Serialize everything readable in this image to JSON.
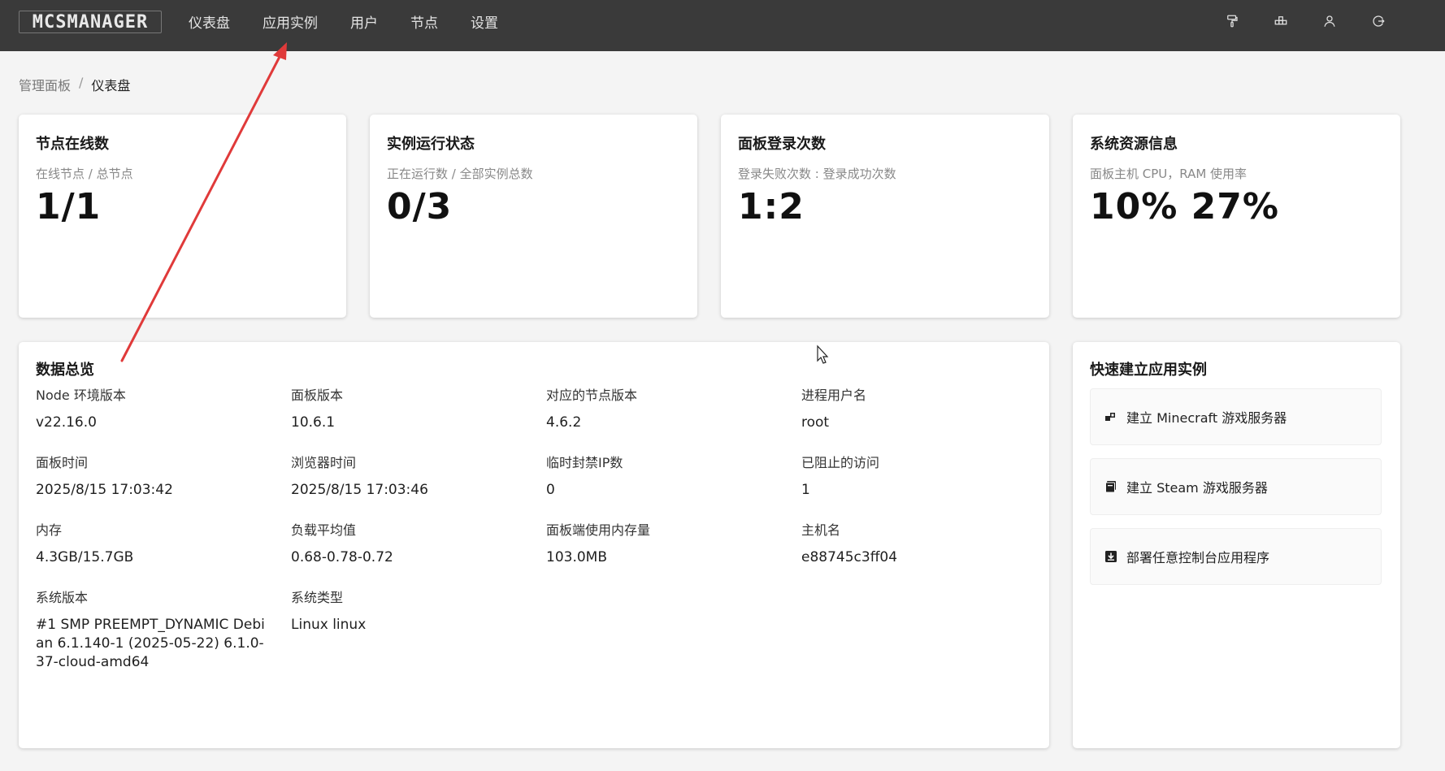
{
  "topbar": {
    "logo": "MCSMANAGER",
    "nav": [
      "仪表盘",
      "应用实例",
      "用户",
      "节点",
      "设置"
    ],
    "icons": [
      "paint-roller-icon",
      "cluster-icon",
      "user-icon",
      "logout-icon"
    ]
  },
  "breadcrumb": {
    "root": "管理面板",
    "separator": "/",
    "current": "仪表盘"
  },
  "stats": [
    {
      "title": "节点在线数",
      "subtitle": "在线节点 / 总节点",
      "value": "1/1"
    },
    {
      "title": "实例运行状态",
      "subtitle": "正在运行数 / 全部实例总数",
      "value": "0/3"
    },
    {
      "title": "面板登录次数",
      "subtitle": "登录失败次数 : 登录成功次数",
      "value": "1:2"
    },
    {
      "title": "系统资源信息",
      "subtitle": "面板主机 CPU，RAM 使用率",
      "value": "10% 27%"
    }
  ],
  "overview": {
    "title": "数据总览",
    "items": [
      {
        "label": "Node 环境版本",
        "value": "v22.16.0"
      },
      {
        "label": "面板版本",
        "value": "10.6.1"
      },
      {
        "label": "对应的节点版本",
        "value": "4.6.2"
      },
      {
        "label": "进程用户名",
        "value": "root"
      },
      {
        "label": "面板时间",
        "value": "2025/8/15 17:03:42"
      },
      {
        "label": "浏览器时间",
        "value": "2025/8/15 17:03:46"
      },
      {
        "label": "临时封禁IP数",
        "value": "0"
      },
      {
        "label": "已阻止的访问",
        "value": "1"
      },
      {
        "label": "内存",
        "value": "4.3GB/15.7GB"
      },
      {
        "label": "负载平均值",
        "value": "0.68-0.78-0.72"
      },
      {
        "label": "面板端使用内存量",
        "value": "103.0MB"
      },
      {
        "label": "主机名",
        "value": "e88745c3ff04"
      },
      {
        "label": "系统版本",
        "value": "#1 SMP PREEMPT_DYNAMIC Debian 6.1.140-1 (2025-05-22) 6.1.0-37-cloud-amd64"
      },
      {
        "label": "系统类型",
        "value": "Linux linux"
      }
    ]
  },
  "quick": {
    "title": "快速建立应用实例",
    "items": [
      {
        "label": "建立 Minecraft 游戏服务器",
        "icon": "blocks-icon"
      },
      {
        "label": "建立 Steam 游戏服务器",
        "icon": "steam-box-icon"
      },
      {
        "label": "部署任意控制台应用程序",
        "icon": "download-box-icon"
      }
    ]
  },
  "colors": {
    "topbar": "#3a3a3a",
    "background": "#f4f4f4",
    "annotation_arrow": "#e03a3a"
  }
}
